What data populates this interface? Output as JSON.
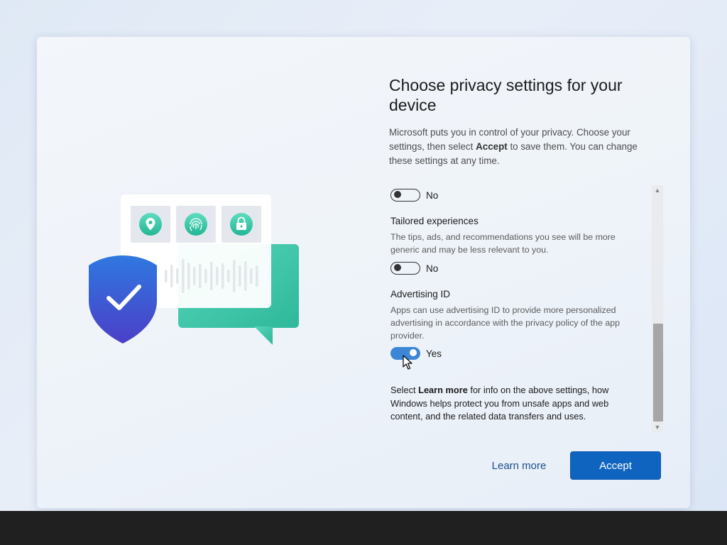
{
  "page": {
    "title": "Choose privacy settings for your device",
    "intro_before": "Microsoft puts you in control of your privacy. Choose your settings, then select ",
    "intro_bold": "Accept",
    "intro_after": " to save them. You can change these settings at any time."
  },
  "settings": {
    "top_toggle": {
      "state": "No",
      "enabled": false
    },
    "tailored": {
      "title": "Tailored experiences",
      "description": "The tips, ads, and recommendations you see will be more generic and may be less relevant to you.",
      "state": "No",
      "enabled": false
    },
    "advertising": {
      "title": "Advertising ID",
      "description": "Apps can use advertising ID to provide more personalized advertising in accordance with the privacy policy of the app provider.",
      "state": "Yes",
      "enabled": true
    },
    "footer_before": "Select ",
    "footer_bold": "Learn more",
    "footer_after": " for info on the above settings, how Windows helps protect you from unsafe apps and web content, and the related data transfers and uses."
  },
  "buttons": {
    "learn_more": "Learn more",
    "accept": "Accept"
  },
  "icons": [
    "location-pin-icon",
    "fingerprint-icon",
    "lock-icon",
    "shield-check-icon",
    "chevron-up-icon",
    "chevron-down-icon"
  ],
  "colors": {
    "accent": "#0f64c0",
    "toggle_on": "#3c86d6",
    "teal": "#3fcaa9",
    "shield": "#3a55d0"
  }
}
